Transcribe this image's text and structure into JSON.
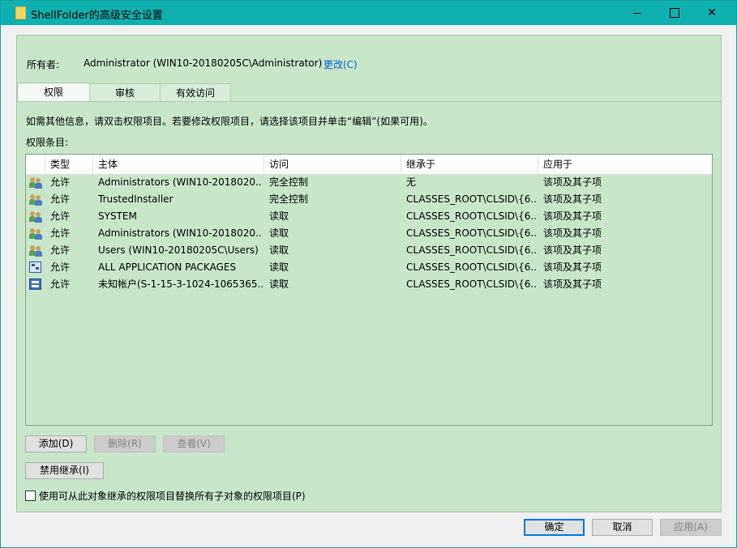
{
  "window": {
    "title": "ShellFolder的高级安全设置",
    "folder_icon": "folder-icon",
    "minimize_label": "",
    "close_label": "✕"
  },
  "owner": {
    "label": "所有者:",
    "value": "Administrator (WIN10-20180205C\\Administrator)",
    "change_link": "更改(C)"
  },
  "tabs": [
    {
      "label": "权限",
      "active": true
    },
    {
      "label": "审核",
      "active": false
    },
    {
      "label": "有效访问",
      "active": false
    }
  ],
  "info_text": "如需其他信息，请双击权限项目。若要修改权限项目，请选择该项目并单击“编辑”(如果可用)。",
  "entries_label": "权限条目:",
  "columns": [
    "类型",
    "主体",
    "访问",
    "继承于",
    "应用于"
  ],
  "entries": [
    {
      "icon": "user-group-icon",
      "type": "允许",
      "principal": "Administrators (WIN10-2018020...",
      "access": "完全控制",
      "inherited_from": "无",
      "applies_to": "该项及其子项"
    },
    {
      "icon": "user-group-icon",
      "type": "允许",
      "principal": "TrustedInstaller",
      "access": "完全控制",
      "inherited_from": "CLASSES_ROOT\\CLSID\\{6...",
      "applies_to": "该项及其子项"
    },
    {
      "icon": "user-group-icon",
      "type": "允许",
      "principal": "SYSTEM",
      "access": "读取",
      "inherited_from": "CLASSES_ROOT\\CLSID\\{6...",
      "applies_to": "该项及其子项"
    },
    {
      "icon": "user-group-icon",
      "type": "允许",
      "principal": "Administrators (WIN10-2018020...",
      "access": "读取",
      "inherited_from": "CLASSES_ROOT\\CLSID\\{6...",
      "applies_to": "该项及其子项"
    },
    {
      "icon": "user-group-icon",
      "type": "允许",
      "principal": "Users (WIN10-20180205C\\Users)",
      "access": "读取",
      "inherited_from": "CLASSES_ROOT\\CLSID\\{6...",
      "applies_to": "该项及其子项"
    },
    {
      "icon": "app-package-icon",
      "type": "允许",
      "principal": "ALL APPLICATION PACKAGES",
      "access": "读取",
      "inherited_from": "CLASSES_ROOT\\CLSID\\{6...",
      "applies_to": "该项及其子项"
    },
    {
      "icon": "unknown-account-icon",
      "type": "允许",
      "principal": "未知帐户(S-1-15-3-1024-1065365...",
      "access": "读取",
      "inherited_from": "CLASSES_ROOT\\CLSID\\{6...",
      "applies_to": "该项及其子项"
    }
  ],
  "buttons": {
    "add": "添加(D)",
    "remove": "删除(R)",
    "view": "查看(V)",
    "disable_inheritance": "禁用继承(I)",
    "ok": "确定",
    "cancel": "取消",
    "apply": "应用(A)"
  },
  "replace_checkbox": {
    "label": "使用可从此对象继承的权限项目替换所有子对象的权限项目(P)",
    "checked": false
  },
  "colors": {
    "titlebar": "#0fb0b0",
    "panel": "#c9e6cb",
    "link": "#0066cc",
    "primary_border": "#0078d7"
  }
}
